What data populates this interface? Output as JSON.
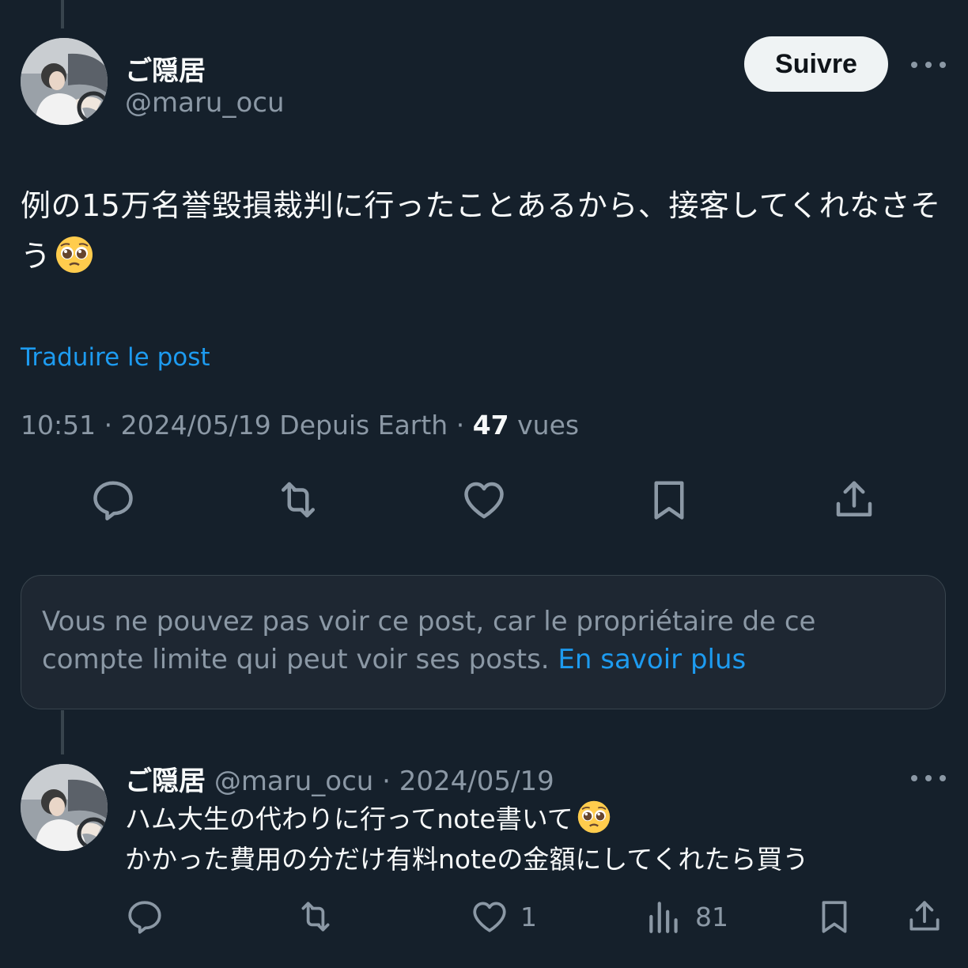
{
  "main_post": {
    "author_name": "ご隠居",
    "author_handle": "@maru_ocu",
    "follow_label": "Suivre",
    "text": "例の15万名誉毀損裁判に行ったことあるから、接客してくれなさそう",
    "translate_label": "Traduire le post",
    "time": "10:51",
    "date": "2024/05/19",
    "source": "Depuis Earth",
    "views_count": "47",
    "views_label": "vues"
  },
  "restricted_notice": {
    "text": "Vous ne pouvez pas voir ce post, car le propriétaire de ce compte limite qui peut voir ses posts.",
    "link_label": "En savoir plus"
  },
  "reply": {
    "author_name": "ご隠居",
    "author_handle": "@maru_ocu",
    "date": "2024/05/19",
    "line1": "ハム大生の代わりに行ってnote書いて",
    "line2": "かかった費用の分だけ有料noteの金額にしてくれたら買う",
    "likes": "1",
    "views": "81"
  },
  "icons": {
    "reply": "speech-bubble-icon",
    "repost": "repost-arrows-icon",
    "like": "heart-icon",
    "bookmark": "bookmark-icon",
    "share": "share-upload-icon",
    "views": "bar-chart-icon",
    "more": "ellipsis-icon",
    "emoji": "pleading-face-emoji"
  },
  "colors": {
    "background": "#15202b",
    "text": "#f7f9f9",
    "secondary_text": "#8b98a5",
    "accent": "#1d9bf0",
    "border": "#38444d"
  }
}
